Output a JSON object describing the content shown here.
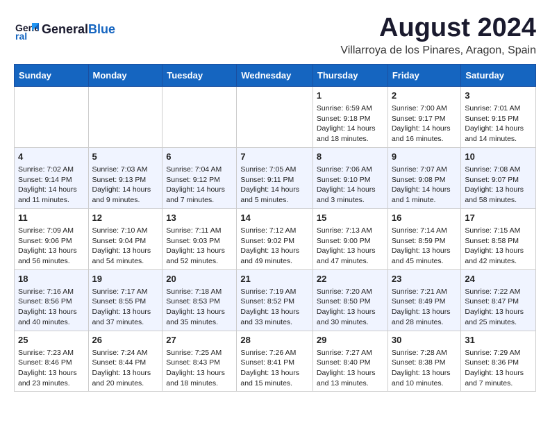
{
  "header": {
    "logo_line1": "General",
    "logo_line2": "Blue",
    "title": "August 2024",
    "subtitle": "Villarroya de los Pinares, Aragon, Spain"
  },
  "days_of_week": [
    "Sunday",
    "Monday",
    "Tuesday",
    "Wednesday",
    "Thursday",
    "Friday",
    "Saturday"
  ],
  "weeks": [
    [
      {
        "day": "",
        "info": ""
      },
      {
        "day": "",
        "info": ""
      },
      {
        "day": "",
        "info": ""
      },
      {
        "day": "",
        "info": ""
      },
      {
        "day": "1",
        "info": "Sunrise: 6:59 AM\nSunset: 9:18 PM\nDaylight: 14 hours and 18 minutes."
      },
      {
        "day": "2",
        "info": "Sunrise: 7:00 AM\nSunset: 9:17 PM\nDaylight: 14 hours and 16 minutes."
      },
      {
        "day": "3",
        "info": "Sunrise: 7:01 AM\nSunset: 9:15 PM\nDaylight: 14 hours and 14 minutes."
      }
    ],
    [
      {
        "day": "4",
        "info": "Sunrise: 7:02 AM\nSunset: 9:14 PM\nDaylight: 14 hours and 11 minutes."
      },
      {
        "day": "5",
        "info": "Sunrise: 7:03 AM\nSunset: 9:13 PM\nDaylight: 14 hours and 9 minutes."
      },
      {
        "day": "6",
        "info": "Sunrise: 7:04 AM\nSunset: 9:12 PM\nDaylight: 14 hours and 7 minutes."
      },
      {
        "day": "7",
        "info": "Sunrise: 7:05 AM\nSunset: 9:11 PM\nDaylight: 14 hours and 5 minutes."
      },
      {
        "day": "8",
        "info": "Sunrise: 7:06 AM\nSunset: 9:10 PM\nDaylight: 14 hours and 3 minutes."
      },
      {
        "day": "9",
        "info": "Sunrise: 7:07 AM\nSunset: 9:08 PM\nDaylight: 14 hours and 1 minute."
      },
      {
        "day": "10",
        "info": "Sunrise: 7:08 AM\nSunset: 9:07 PM\nDaylight: 13 hours and 58 minutes."
      }
    ],
    [
      {
        "day": "11",
        "info": "Sunrise: 7:09 AM\nSunset: 9:06 PM\nDaylight: 13 hours and 56 minutes."
      },
      {
        "day": "12",
        "info": "Sunrise: 7:10 AM\nSunset: 9:04 PM\nDaylight: 13 hours and 54 minutes."
      },
      {
        "day": "13",
        "info": "Sunrise: 7:11 AM\nSunset: 9:03 PM\nDaylight: 13 hours and 52 minutes."
      },
      {
        "day": "14",
        "info": "Sunrise: 7:12 AM\nSunset: 9:02 PM\nDaylight: 13 hours and 49 minutes."
      },
      {
        "day": "15",
        "info": "Sunrise: 7:13 AM\nSunset: 9:00 PM\nDaylight: 13 hours and 47 minutes."
      },
      {
        "day": "16",
        "info": "Sunrise: 7:14 AM\nSunset: 8:59 PM\nDaylight: 13 hours and 45 minutes."
      },
      {
        "day": "17",
        "info": "Sunrise: 7:15 AM\nSunset: 8:58 PM\nDaylight: 13 hours and 42 minutes."
      }
    ],
    [
      {
        "day": "18",
        "info": "Sunrise: 7:16 AM\nSunset: 8:56 PM\nDaylight: 13 hours and 40 minutes."
      },
      {
        "day": "19",
        "info": "Sunrise: 7:17 AM\nSunset: 8:55 PM\nDaylight: 13 hours and 37 minutes."
      },
      {
        "day": "20",
        "info": "Sunrise: 7:18 AM\nSunset: 8:53 PM\nDaylight: 13 hours and 35 minutes."
      },
      {
        "day": "21",
        "info": "Sunrise: 7:19 AM\nSunset: 8:52 PM\nDaylight: 13 hours and 33 minutes."
      },
      {
        "day": "22",
        "info": "Sunrise: 7:20 AM\nSunset: 8:50 PM\nDaylight: 13 hours and 30 minutes."
      },
      {
        "day": "23",
        "info": "Sunrise: 7:21 AM\nSunset: 8:49 PM\nDaylight: 13 hours and 28 minutes."
      },
      {
        "day": "24",
        "info": "Sunrise: 7:22 AM\nSunset: 8:47 PM\nDaylight: 13 hours and 25 minutes."
      }
    ],
    [
      {
        "day": "25",
        "info": "Sunrise: 7:23 AM\nSunset: 8:46 PM\nDaylight: 13 hours and 23 minutes."
      },
      {
        "day": "26",
        "info": "Sunrise: 7:24 AM\nSunset: 8:44 PM\nDaylight: 13 hours and 20 minutes."
      },
      {
        "day": "27",
        "info": "Sunrise: 7:25 AM\nSunset: 8:43 PM\nDaylight: 13 hours and 18 minutes."
      },
      {
        "day": "28",
        "info": "Sunrise: 7:26 AM\nSunset: 8:41 PM\nDaylight: 13 hours and 15 minutes."
      },
      {
        "day": "29",
        "info": "Sunrise: 7:27 AM\nSunset: 8:40 PM\nDaylight: 13 hours and 13 minutes."
      },
      {
        "day": "30",
        "info": "Sunrise: 7:28 AM\nSunset: 8:38 PM\nDaylight: 13 hours and 10 minutes."
      },
      {
        "day": "31",
        "info": "Sunrise: 7:29 AM\nSunset: 8:36 PM\nDaylight: 13 hours and 7 minutes."
      }
    ]
  ]
}
